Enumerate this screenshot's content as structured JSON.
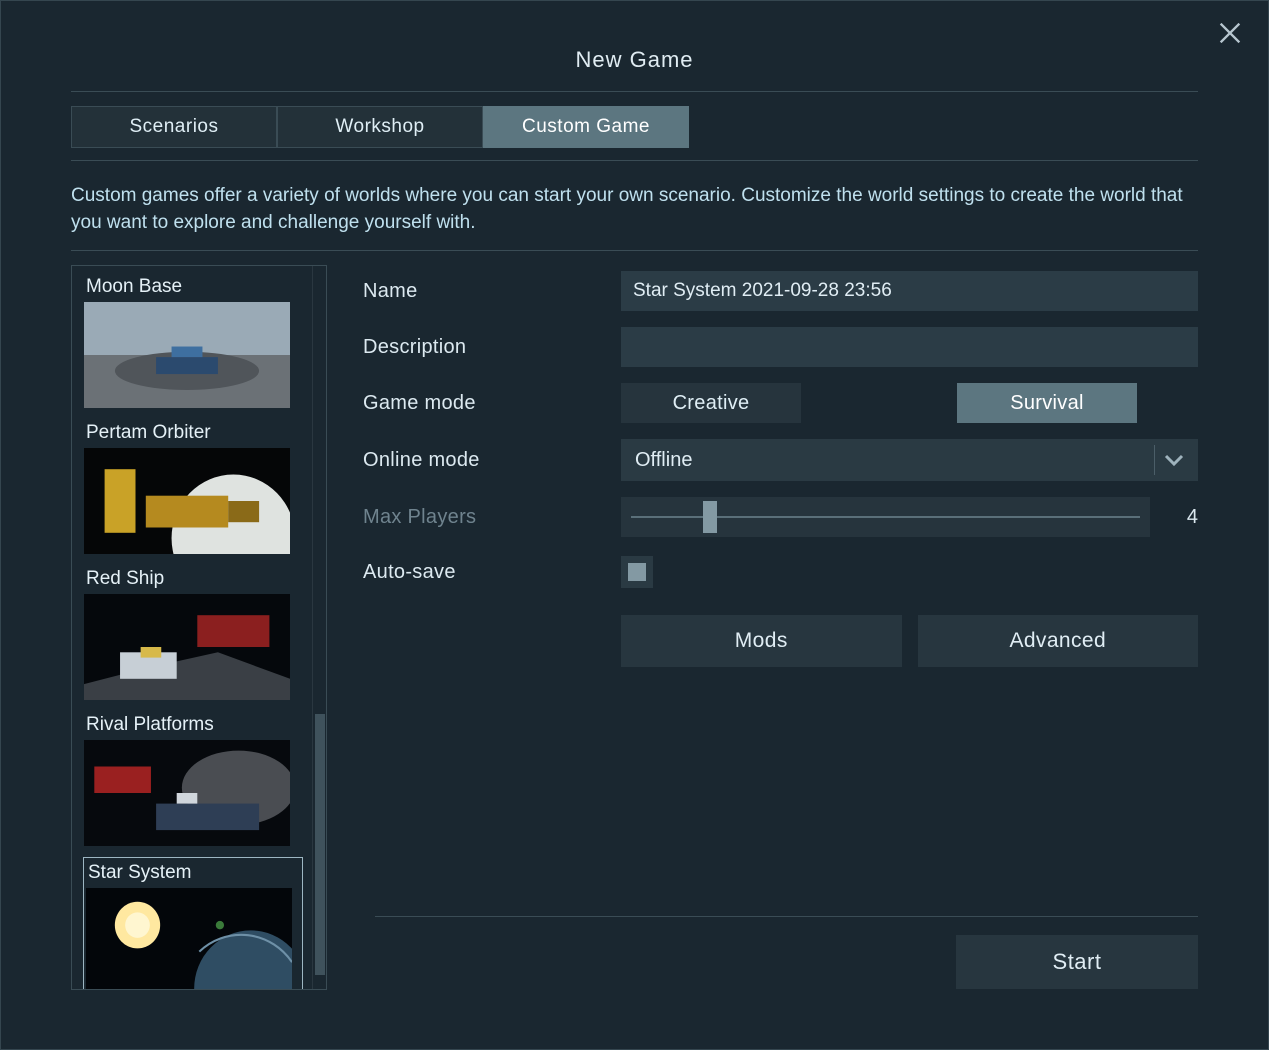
{
  "header": {
    "title": "New Game"
  },
  "tabs": [
    {
      "label": "Scenarios",
      "active": false
    },
    {
      "label": "Workshop",
      "active": false
    },
    {
      "label": "Custom Game",
      "active": true
    }
  ],
  "description": "Custom games offer a variety of worlds where you can start your own scenario. Customize the world settings to create the world that you want to explore and challenge yourself with.",
  "scenarios": [
    {
      "label": "Moon Base",
      "selected": false
    },
    {
      "label": "Pertam Orbiter",
      "selected": false
    },
    {
      "label": "Red Ship",
      "selected": false
    },
    {
      "label": "Rival Platforms",
      "selected": false
    },
    {
      "label": "Star System",
      "selected": true
    }
  ],
  "form": {
    "name": {
      "label": "Name",
      "value": "Star System 2021-09-28 23:56"
    },
    "description": {
      "label": "Description",
      "value": ""
    },
    "game_mode": {
      "label": "Game mode",
      "creative_label": "Creative",
      "survival_label": "Survival",
      "selected": "Survival"
    },
    "online_mode": {
      "label": "Online mode",
      "value": "Offline"
    },
    "max_players": {
      "label": "Max Players",
      "value": "4",
      "disabled": true
    },
    "auto_save": {
      "label": "Auto-save",
      "checked": true
    },
    "mods_label": "Mods",
    "advanced_label": "Advanced",
    "start_label": "Start"
  }
}
